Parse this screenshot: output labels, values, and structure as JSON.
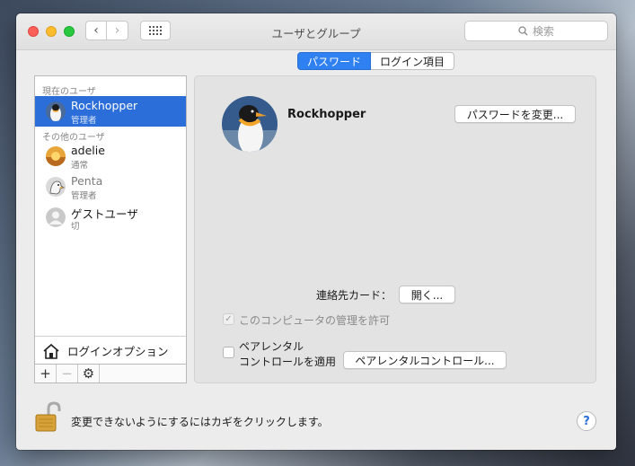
{
  "window": {
    "title": "ユーザとグループ"
  },
  "toolbar": {
    "back_icon": "‹",
    "forward_icon": "›",
    "search_placeholder": "検索"
  },
  "sidebar": {
    "current_users_label": "現在のユーザ",
    "other_users_label": "その他のユーザ",
    "current_user": {
      "name": "Rockhopper",
      "role": "管理者"
    },
    "other_users": [
      {
        "name": "adelie",
        "role": "通常"
      },
      {
        "name": "Penta",
        "role": "管理者"
      },
      {
        "name": "ゲストユーザ",
        "role": "切"
      }
    ],
    "login_options_label": "ログインオプション",
    "add_label": "+",
    "remove_label": "−"
  },
  "tabs": {
    "password": "パスワード",
    "login_items": "ログイン項目"
  },
  "detail": {
    "user_name": "Rockhopper",
    "change_password_button": "パスワードを変更...",
    "contact_card_label": "連絡先カード：",
    "open_button": "開く...",
    "allow_admin_label": "このコンピュータの管理を許可",
    "parental_line1": "ペアレンタル",
    "parental_line2": "コントロールを適用",
    "parental_button": "ペアレンタルコントロール..."
  },
  "footer": {
    "lock_text": "変更できないようにするにはカギをクリックします。",
    "help_label": "?"
  }
}
